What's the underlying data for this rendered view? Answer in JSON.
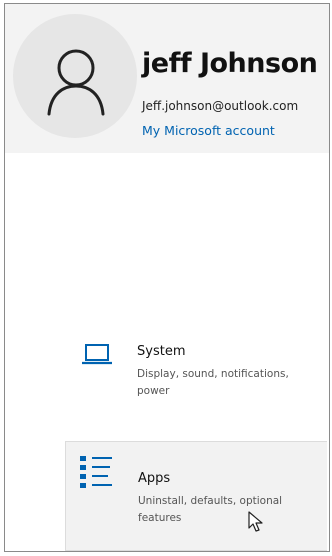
{
  "account": {
    "name": "jeff Johnson",
    "email": "Jeff.johnson@outlook.com",
    "link_label": "My Microsoft account",
    "avatar_icon": "person-icon"
  },
  "items": [
    {
      "title": "System",
      "description": "Display, sound, notifications, power",
      "icon": "laptop-icon"
    },
    {
      "title": "Apps",
      "description": "Uninstall, defaults, optional features",
      "icon": "apps-list-icon"
    }
  ],
  "colors": {
    "accent": "#0063b1",
    "header_bg": "#f3f3f3",
    "hover_bg": "#f2f2f2"
  }
}
